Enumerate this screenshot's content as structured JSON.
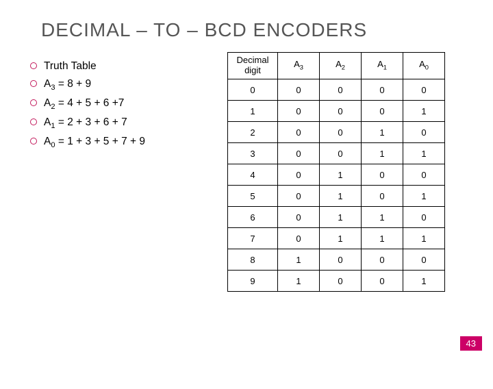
{
  "title": "DECIMAL – TO – BCD ENCODERS",
  "bullets": [
    {
      "pre": "Truth Table",
      "sub": "",
      "post": ""
    },
    {
      "pre": "A",
      "sub": "3",
      "post": " = 8 + 9"
    },
    {
      "pre": "A",
      "sub": "2",
      "post": " = 4 + 5 + 6 +7"
    },
    {
      "pre": "A",
      "sub": "1",
      "post": " = 2 + 3 + 6 + 7"
    },
    {
      "pre": "A",
      "sub": "0",
      "post": " = 1 + 3 + 5 + 7 + 9"
    }
  ],
  "table": {
    "headers": [
      {
        "pre": "Decimal\ndigit",
        "sub": ""
      },
      {
        "pre": "A",
        "sub": "3"
      },
      {
        "pre": "A",
        "sub": "2"
      },
      {
        "pre": "A",
        "sub": "1"
      },
      {
        "pre": "A",
        "sub": "0"
      }
    ]
  },
  "chart_data": {
    "type": "table",
    "title": "Decimal to BCD Encoder Truth Table",
    "columns": [
      "Decimal digit",
      "A3",
      "A2",
      "A1",
      "A0"
    ],
    "rows": [
      [
        "0",
        "0",
        "0",
        "0",
        "0"
      ],
      [
        "1",
        "0",
        "0",
        "0",
        "1"
      ],
      [
        "2",
        "0",
        "0",
        "1",
        "0"
      ],
      [
        "3",
        "0",
        "0",
        "1",
        "1"
      ],
      [
        "4",
        "0",
        "1",
        "0",
        "0"
      ],
      [
        "5",
        "0",
        "1",
        "0",
        "1"
      ],
      [
        "6",
        "0",
        "1",
        "1",
        "0"
      ],
      [
        "7",
        "0",
        "1",
        "1",
        "1"
      ],
      [
        "8",
        "1",
        "0",
        "0",
        "0"
      ],
      [
        "9",
        "1",
        "0",
        "0",
        "1"
      ]
    ]
  },
  "page_number": "43"
}
